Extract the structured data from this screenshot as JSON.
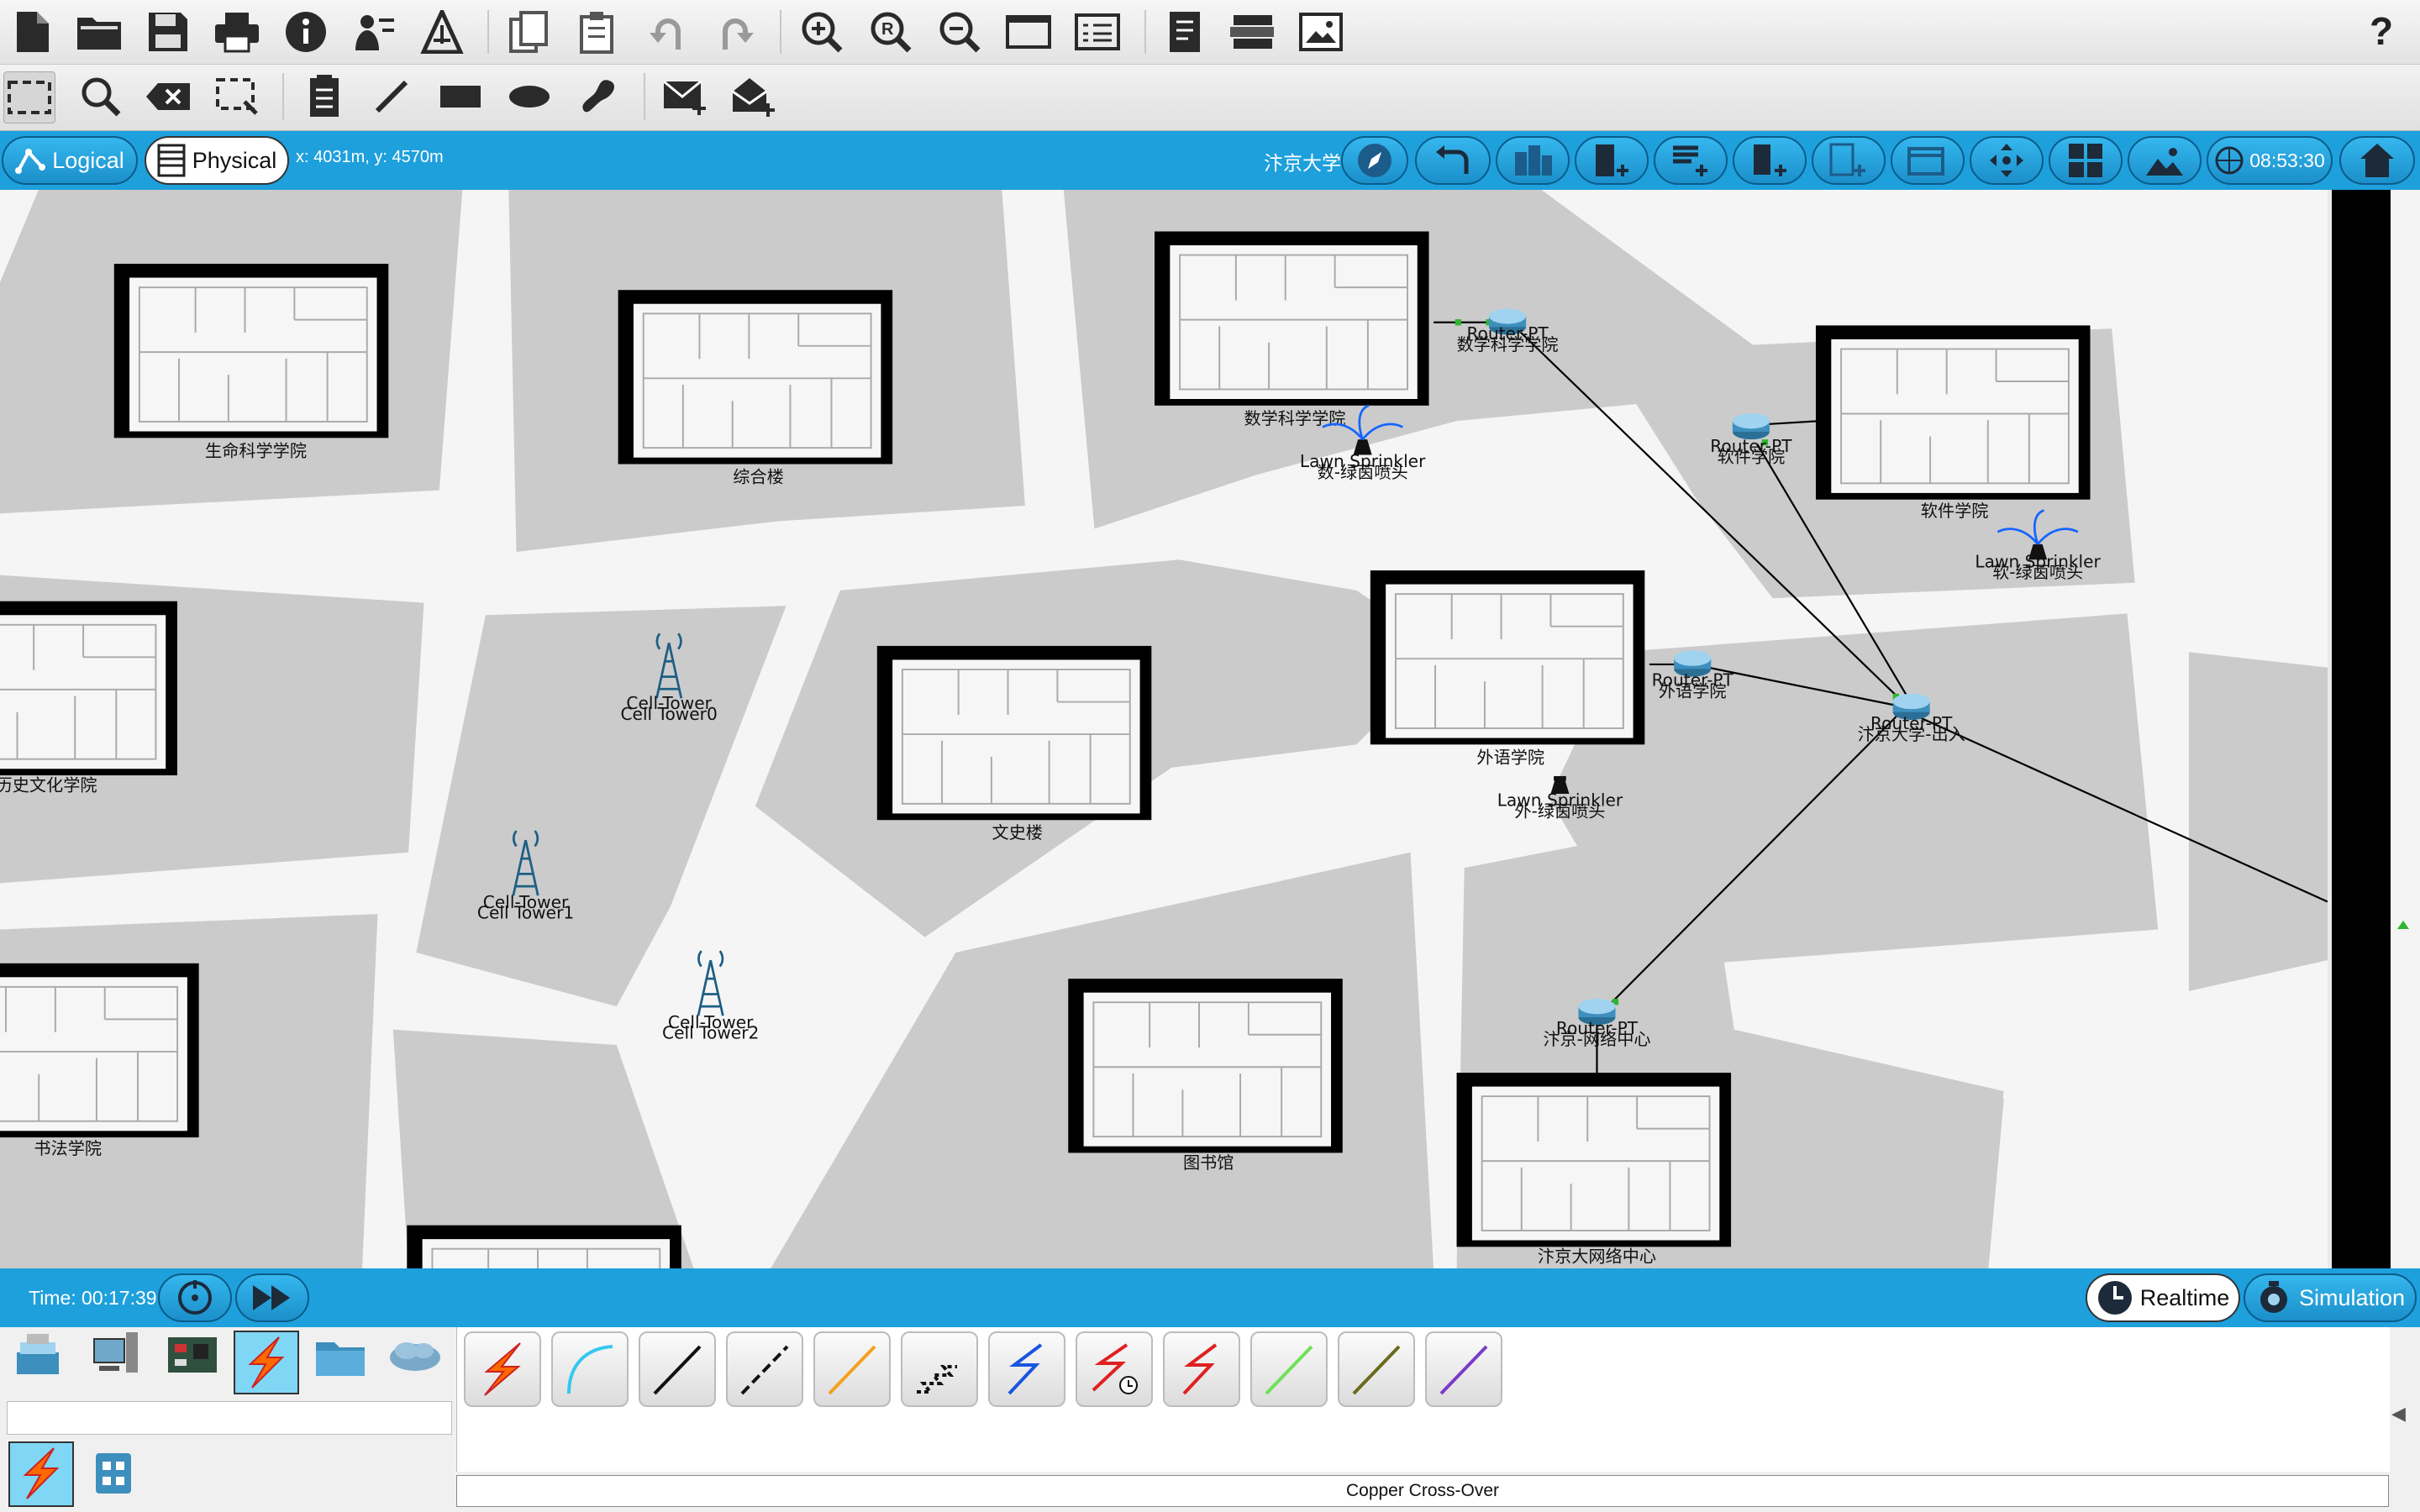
{
  "toolbar_main": {
    "icons": [
      "new-file",
      "open-folder",
      "save",
      "print",
      "info",
      "activity-wizard",
      "custom-device",
      "copy",
      "paste",
      "undo",
      "redo",
      "zoom-in",
      "zoom-reset",
      "zoom-out",
      "palette",
      "custom-device-dialog",
      "notes",
      "device-list",
      "image-view"
    ],
    "help": "?"
  },
  "toolbar_draw": {
    "icons": [
      "select",
      "inspect",
      "delete",
      "resize",
      "note",
      "line",
      "rectangle",
      "ellipse",
      "freeform",
      "add-simple-pdu",
      "add-complex-pdu"
    ]
  },
  "view_bar": {
    "logical_label": "Logical",
    "physical_label": "Physical",
    "coords": "x: 4031m, y: 4570m",
    "location_name": "汴京大学",
    "clock": "08:53:30"
  },
  "map": {
    "buildings": [
      "生命科学学院",
      "综合楼",
      "数学科学学院",
      "软件学院",
      "历史文化学院",
      "文史楼",
      "外语学院",
      "书法学院",
      "图书馆",
      "汴京大网络中心"
    ],
    "routers": [
      {
        "model": "Router-PT",
        "name": "数学科学学院"
      },
      {
        "model": "Router-PT",
        "name": "软件学院"
      },
      {
        "model": "Router-PT",
        "name": "外语学院"
      },
      {
        "model": "Router-PT",
        "name": "汴京大学-出入"
      },
      {
        "model": "Router-PT",
        "name": "汴京-网络中心"
      }
    ],
    "sprinklers": [
      {
        "model": "Lawn Sprinkler",
        "name": "数-绿茵喷头"
      },
      {
        "model": "Lawn Sprinkler",
        "name": "软-绿茵喷头"
      },
      {
        "model": "Lawn Sprinkler",
        "name": "外-绿茵喷头"
      }
    ],
    "towers": [
      {
        "model": "Cell-Tower",
        "name": "Cell Tower0"
      },
      {
        "model": "Cell-Tower",
        "name": "Cell Tower1"
      },
      {
        "model": "Cell-Tower",
        "name": "Cell Tower2"
      }
    ]
  },
  "bottom_bar": {
    "time": "Time: 00:17:39",
    "realtime_label": "Realtime",
    "simulation_label": "Simulation"
  },
  "device_panel": {
    "categories": [
      "network-devices",
      "end-devices",
      "components",
      "connections",
      "misc",
      "multiuser"
    ],
    "selected_category": "connections",
    "connection_types": [
      "automatic",
      "console",
      "copper-straight-through",
      "copper-cross-over",
      "fiber",
      "phone",
      "coaxial",
      "serial-dce",
      "serial-dte",
      "octal",
      "iot-custom",
      "usb"
    ],
    "selected_connection_label": "Copper Cross-Over"
  },
  "colors": {
    "accent": "#1ea0dc",
    "pill_border": "#0a5c8a",
    "road": "#f6f6f6",
    "block": "#c8c8c8"
  }
}
